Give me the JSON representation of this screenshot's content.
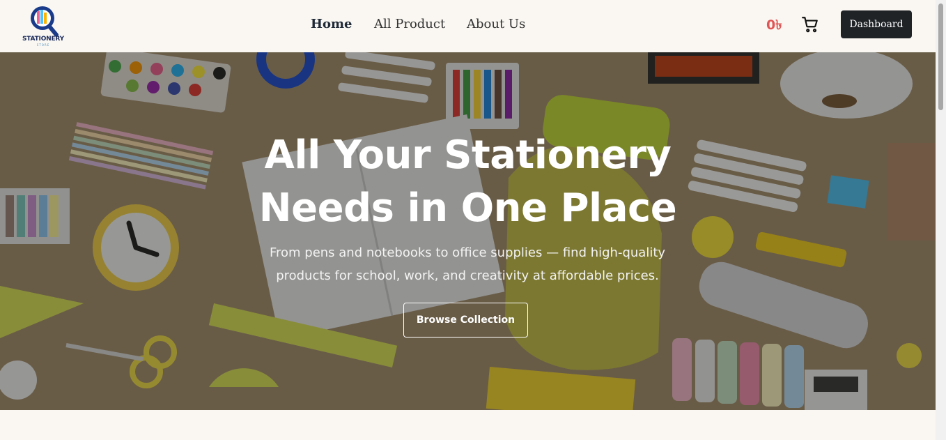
{
  "brand": {
    "name": "STATIONERY",
    "tagline": "STORE"
  },
  "nav": {
    "home": "Home",
    "products": "All Product",
    "about": "About Us"
  },
  "cart": {
    "count": "0৳"
  },
  "dashboard_label": "Dashboard",
  "hero": {
    "title_line1": "All Your Stationery",
    "title_line2": "Needs in One Place",
    "subtitle": "From pens and notebooks to office supplies — find high-quality products for school, work, and creativity at affordable prices.",
    "cta": "Browse Collection"
  },
  "colors": {
    "accent": "#e05656",
    "dark_button": "#1f2326",
    "page_bg": "#faf7f2"
  }
}
